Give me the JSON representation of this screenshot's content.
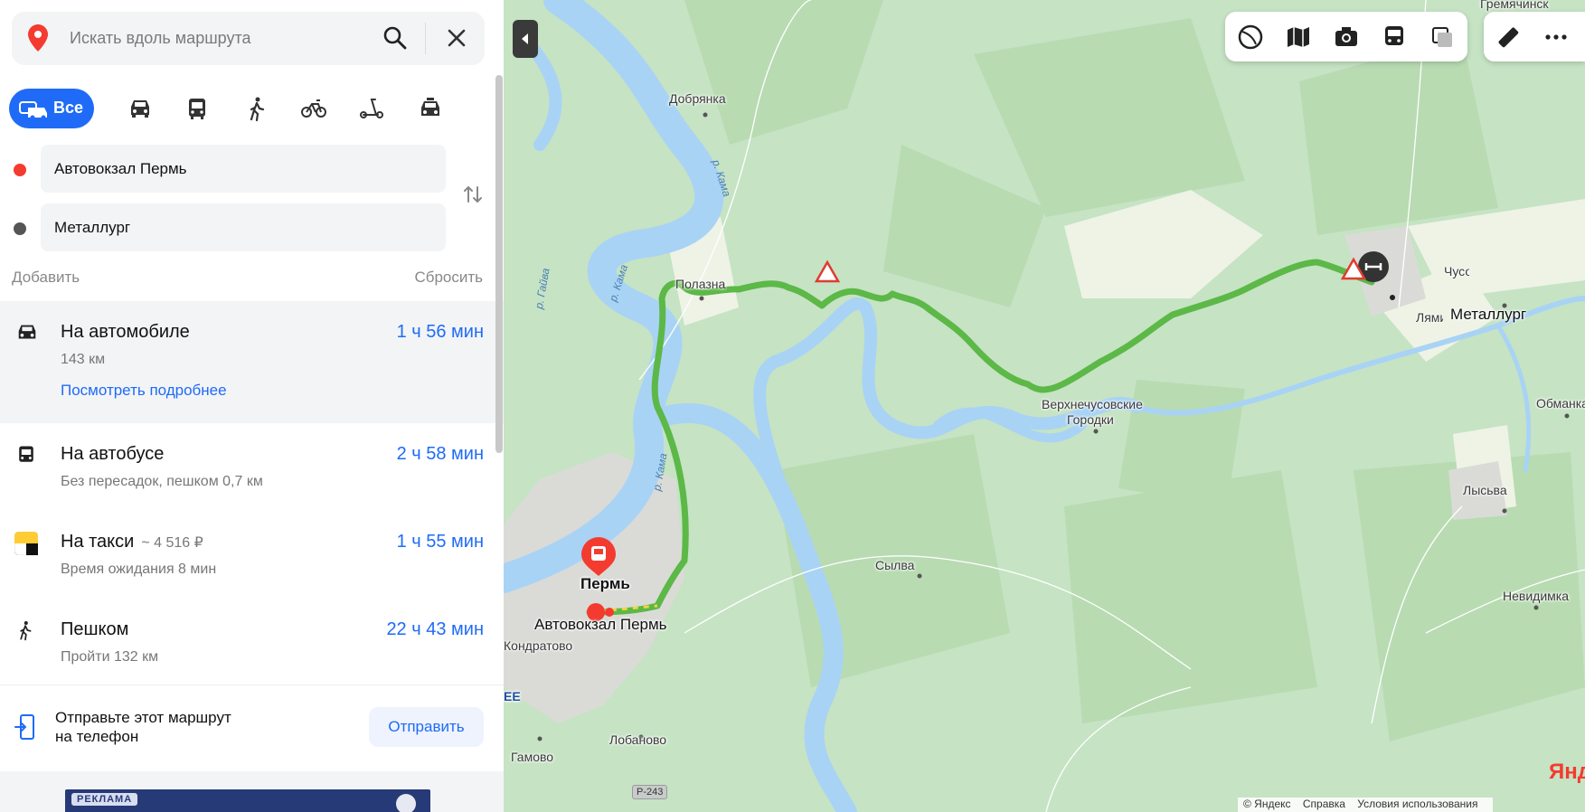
{
  "search": {
    "placeholder": "Искать вдоль маршрута"
  },
  "modes": {
    "all_label": "Все"
  },
  "points": {
    "from": "Автовокзал Пермь",
    "to": "Металлург"
  },
  "actions": {
    "add": "Добавить",
    "reset": "Сбросить"
  },
  "routes": {
    "car": {
      "name": "На автомобиле",
      "time": "1 ч 56 мин",
      "sub": "143 км",
      "more": "Посмотреть подробнее"
    },
    "bus": {
      "name": "На автобусе",
      "time": "2 ч 58 мин",
      "sub": "Без пересадок, пешком 0,7 км"
    },
    "taxi": {
      "name": "На такси",
      "price": "~ 4 516 ₽",
      "time": "1 ч 55 мин",
      "sub": "Время ожидания 8 мин"
    },
    "walk": {
      "name": "Пешком",
      "time": "22 ч 43 мин",
      "sub": "Пройти 132 км"
    }
  },
  "send": {
    "text_line1": "Отправьте этот маршрут",
    "text_line2": "на телефон",
    "button": "Отправить"
  },
  "ad": {
    "tag": "РЕКЛАМА"
  },
  "map": {
    "labels": {
      "dobryanka": "Добрянка",
      "polazna": "Полазна",
      "verkhnechusovskie_1": "Верхнечусовские",
      "verkhnechusovskie_2": "Городки",
      "sylva": "Сылва",
      "perm": "Пермь",
      "bus_station": "Автовокзал Пермь",
      "kondratovo": "Кондратово",
      "lobanovo": "Лобаново",
      "gamovo": "Гамово",
      "lysva": "Лысьва",
      "nevidimka": "Невидимка",
      "obmanka": "Обманка",
      "lyami": "Лямино",
      "metallurg": "Металлург",
      "chusovoy": "Чусовой",
      "gremyachinsk": "Гремячинск",
      "kama1": "р. Кама",
      "kama2": "р. Кама",
      "kama3": "р. Кама",
      "gayva": "р. Гайва",
      "road": "Р-243",
      "ee": "EE"
    },
    "copyright": {
      "brand": "© Яндекс",
      "help": "Справка",
      "terms": "Условия использования"
    },
    "logo": "Янд"
  },
  "colors": {
    "accent": "#1f6bf7",
    "route": "#5cb847",
    "start": "#f43b2f",
    "end": "#555555"
  }
}
